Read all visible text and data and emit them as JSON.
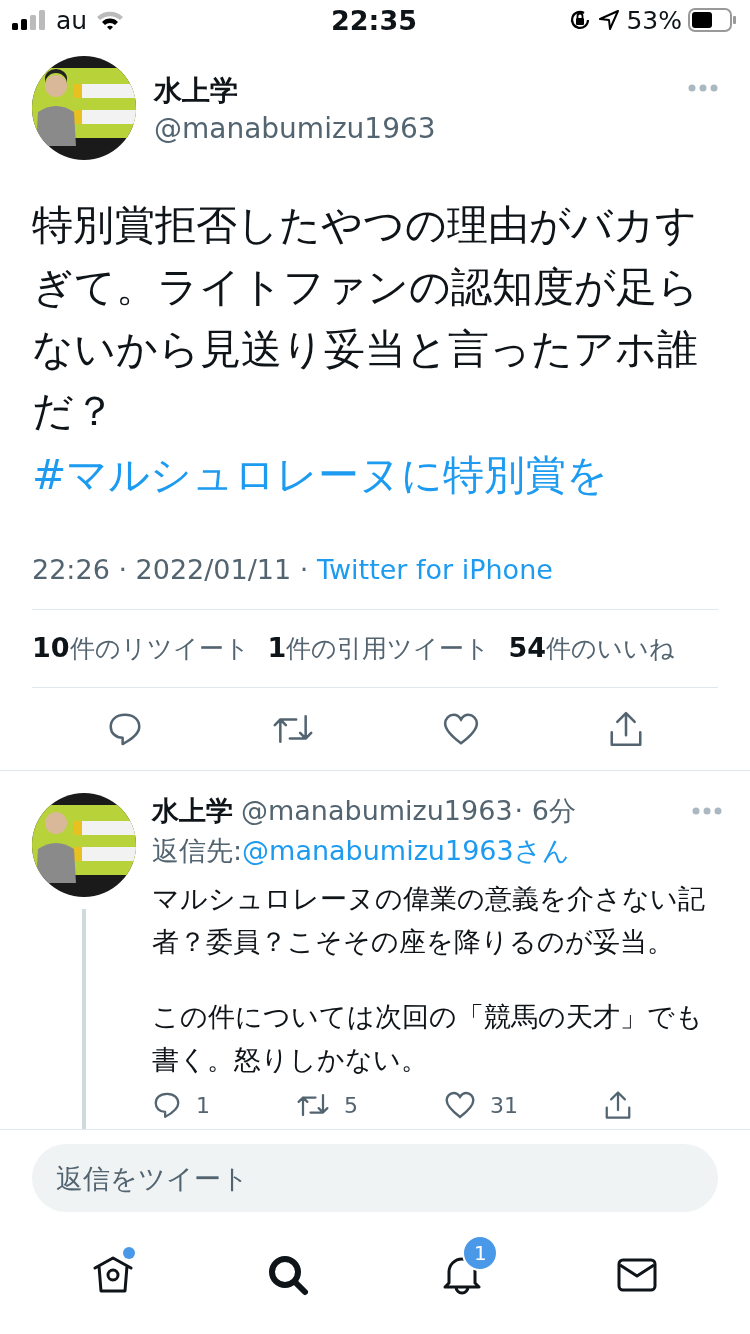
{
  "status_bar": {
    "carrier": "au",
    "time": "22:35",
    "battery": "53%"
  },
  "tweet": {
    "name": "水上学",
    "handle": "@manabumizu1963",
    "text": "特別賞拒否したやつの理由がバカすぎて。ライトファンの認知度が足らないから見送り妥当と言ったアホ誰だ？",
    "hashtag": "#マルシュロレーヌに特別賞を",
    "timestamp": "22:26 · 2022/01/11 · ",
    "source": "Twitter for iPhone",
    "stats": [
      "**10**件のリツイート",
      "**1**件の引用ツイート",
      "**54**件のいいね"
    ],
    "actions": [
      {
        "kind": "reply"
      },
      {
        "kind": "retweet"
      },
      {
        "kind": "like"
      },
      {
        "kind": "share"
      }
    ]
  },
  "reply": {
    "name": "水上学",
    "handle": "@manabumizu1963",
    "time": "· 6分",
    "reply_to_label": "返信先:",
    "reply_to": "@manabumizu1963さん",
    "paragraphs": [
      "マルシュロレーヌの偉業の意義を介さない記者？委員？こそその座を降りるのが妥当。",
      "この件については次回の「競馬の天才」でも書く。怒りしかない。"
    ],
    "actions": [
      {
        "kind": "reply",
        "count": "1"
      },
      {
        "kind": "retweet",
        "count": "5"
      },
      {
        "kind": "like",
        "count": "31"
      },
      {
        "kind": "share"
      }
    ]
  },
  "reply_field": {
    "placeholder": "返信をツイート"
  },
  "tab_bar": [
    {
      "kind": "home",
      "dot": true
    },
    {
      "kind": "search",
      "dot": false
    },
    {
      "kind": "notifications",
      "dot": false,
      "badge": "1"
    },
    {
      "kind": "messages",
      "dot": false
    }
  ]
}
